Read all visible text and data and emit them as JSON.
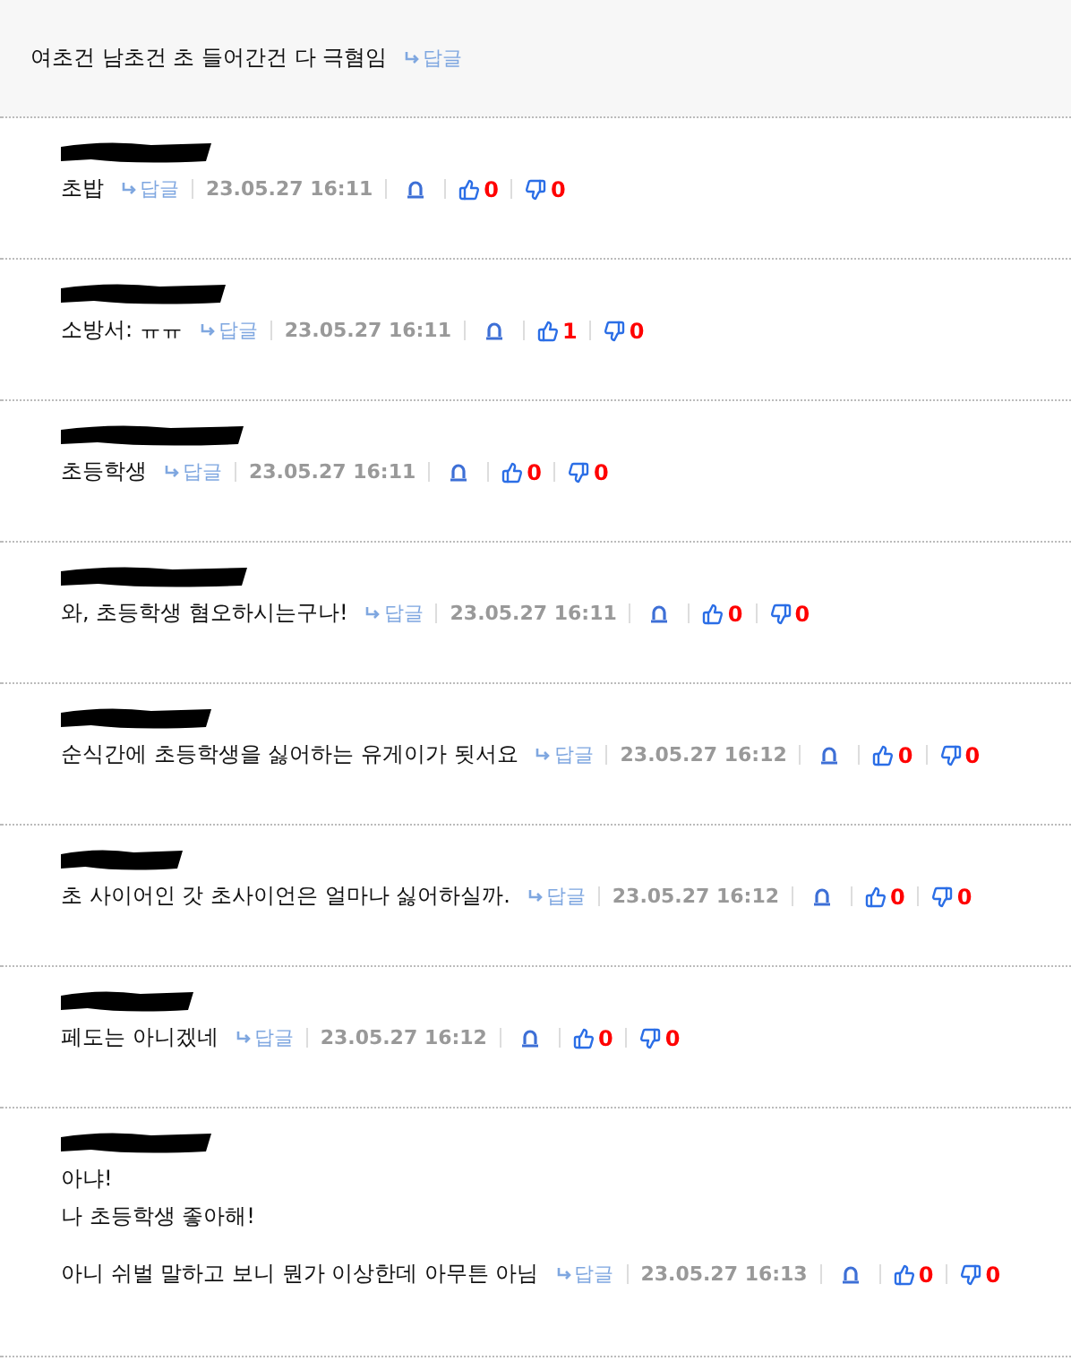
{
  "post": {
    "text": "여초건 남초건 초 들어간건 다 극혐임",
    "reply_label": "답글"
  },
  "comments": [
    {
      "paragraphs": [
        [
          "초밥"
        ]
      ],
      "reply_label": "답글",
      "time": "23.05.27 16:11",
      "likes": "0",
      "dislikes": "0"
    },
    {
      "paragraphs": [
        [
          "소방서: ㅠㅠ"
        ]
      ],
      "reply_label": "답글",
      "time": "23.05.27 16:11",
      "likes": "1",
      "dislikes": "0"
    },
    {
      "paragraphs": [
        [
          "초등학생"
        ]
      ],
      "reply_label": "답글",
      "time": "23.05.27 16:11",
      "likes": "0",
      "dislikes": "0"
    },
    {
      "paragraphs": [
        [
          "와, 초등학생 혐오하시는구나!"
        ]
      ],
      "reply_label": "답글",
      "time": "23.05.27 16:11",
      "likes": "0",
      "dislikes": "0"
    },
    {
      "paragraphs": [
        [
          "순식간에 초등학생을 싫어하는 유게이가 됫서요"
        ]
      ],
      "reply_label": "답글",
      "time": "23.05.27 16:12",
      "likes": "0",
      "dislikes": "0"
    },
    {
      "paragraphs": [
        [
          "초 사이어인 갓 초사이언은 얼마나 싫어하실까."
        ]
      ],
      "reply_label": "답글",
      "time": "23.05.27 16:12",
      "likes": "0",
      "dislikes": "0"
    },
    {
      "paragraphs": [
        [
          "페도는 아니겠네"
        ]
      ],
      "reply_label": "답글",
      "time": "23.05.27 16:12",
      "likes": "0",
      "dislikes": "0"
    },
    {
      "paragraphs": [
        [
          "아냐!",
          "나 초등학생 좋아해!"
        ],
        [
          "아니 쉬벌 말하고 보니 뭔가 이상한데 아무튼 아님"
        ]
      ],
      "reply_label": "답글",
      "time": "23.05.27 16:13",
      "likes": "0",
      "dislikes": "0"
    }
  ]
}
